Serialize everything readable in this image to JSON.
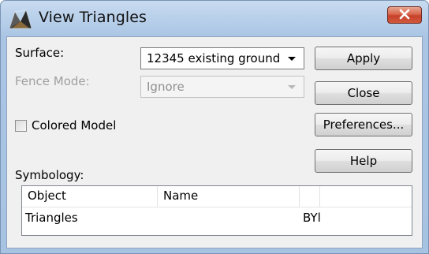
{
  "window": {
    "title": "View Triangles",
    "close_label": "✕"
  },
  "form": {
    "surface_label": "Surface:",
    "surface_value": "12345 existing ground",
    "fence_label": "Fence Mode:",
    "fence_value": "Ignore",
    "colored_model_label": "Colored Model",
    "colored_model_checked": false,
    "symbology_label": "Symbology:"
  },
  "buttons": {
    "apply": "Apply",
    "close": "Close",
    "preferences": "Preferences...",
    "help": "Help"
  },
  "table": {
    "columns": [
      "Object",
      "Name",
      ""
    ],
    "rows": [
      {
        "object": "Triangles",
        "name": "",
        "symbology": "BYl"
      }
    ]
  },
  "colors": {
    "titlebar": "#b9d0ea",
    "close_button": "#d15a3e",
    "client_bg": "#f0f0f0"
  }
}
